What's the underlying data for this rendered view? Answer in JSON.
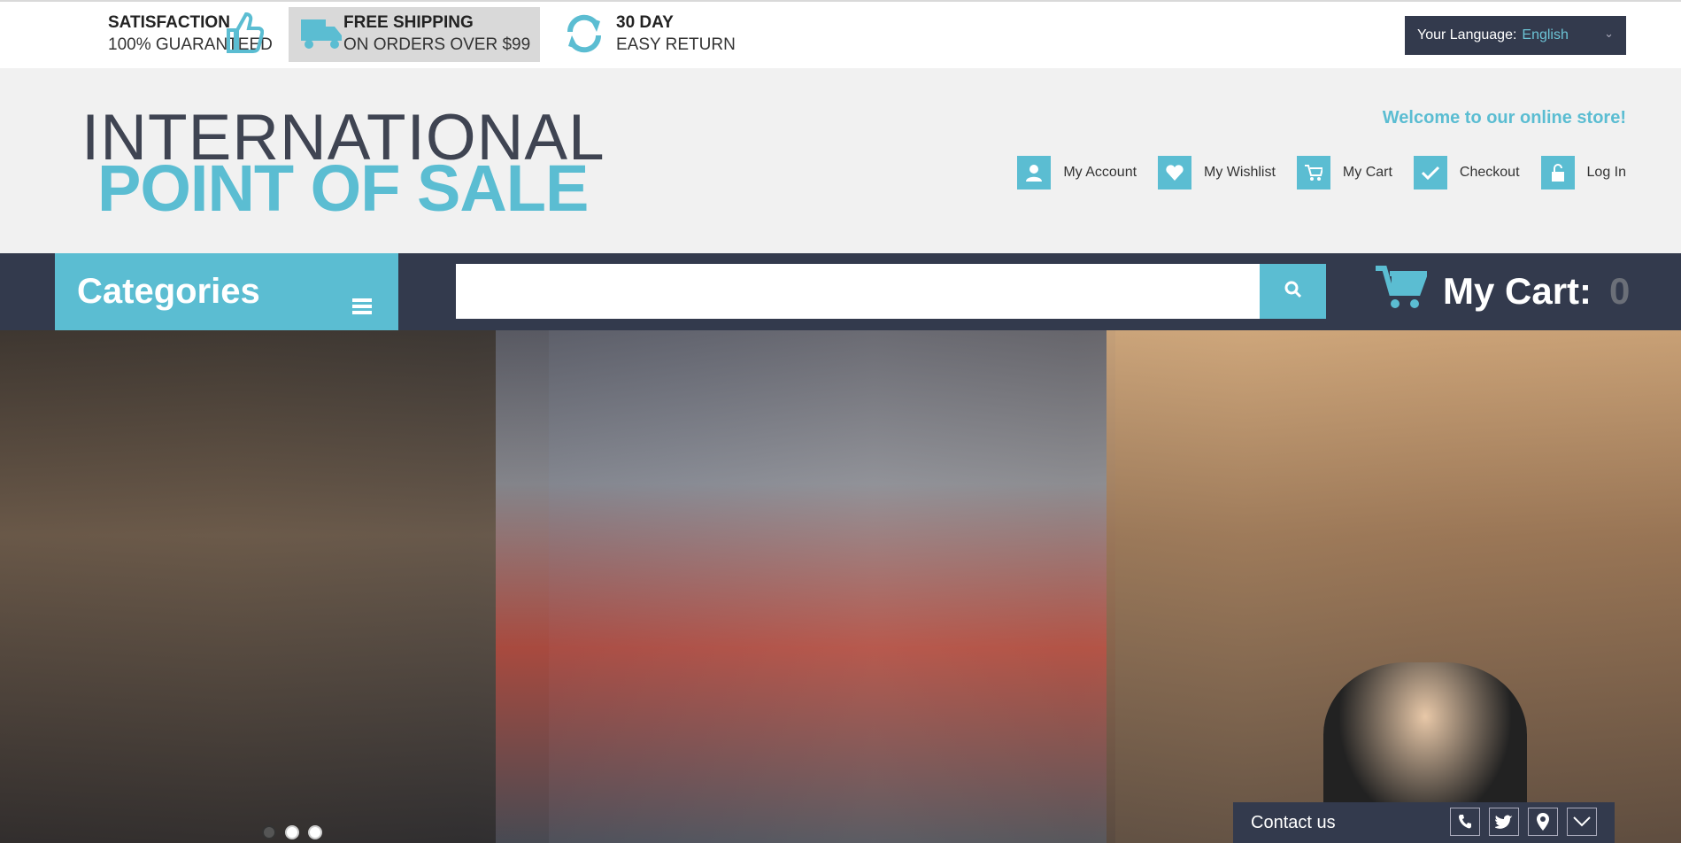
{
  "topbar": {
    "promos": [
      {
        "title": "SATISFACTION",
        "subtitle": "100% GUARANTEED",
        "icon": "thumbs-up-icon"
      },
      {
        "title": "FREE SHIPPING",
        "subtitle": "ON ORDERS OVER $99",
        "icon": "truck-icon"
      },
      {
        "title": "30 DAY",
        "subtitle": "EASY RETURN",
        "icon": "refresh-icon"
      }
    ],
    "language": {
      "label": "Your Language:",
      "value": "English"
    }
  },
  "header": {
    "logo_line1": "INTERNATIONAL",
    "logo_line2": "POINT OF SALE",
    "welcome": "Welcome to our online store!",
    "links": [
      {
        "label": "My Account",
        "icon": "user-icon"
      },
      {
        "label": "My Wishlist",
        "icon": "heart-icon"
      },
      {
        "label": "My Cart",
        "icon": "cart-icon"
      },
      {
        "label": "Checkout",
        "icon": "check-icon"
      },
      {
        "label": "Log In",
        "icon": "unlock-icon"
      }
    ]
  },
  "nav": {
    "categories_label": "Categories",
    "search_placeholder": "",
    "cart_label": "My Cart:",
    "cart_count": "0"
  },
  "contact": {
    "label": "Contact us"
  },
  "colors": {
    "accent": "#5bbdd2",
    "dark": "#333a4d",
    "header_bg": "#f1f1f1"
  }
}
